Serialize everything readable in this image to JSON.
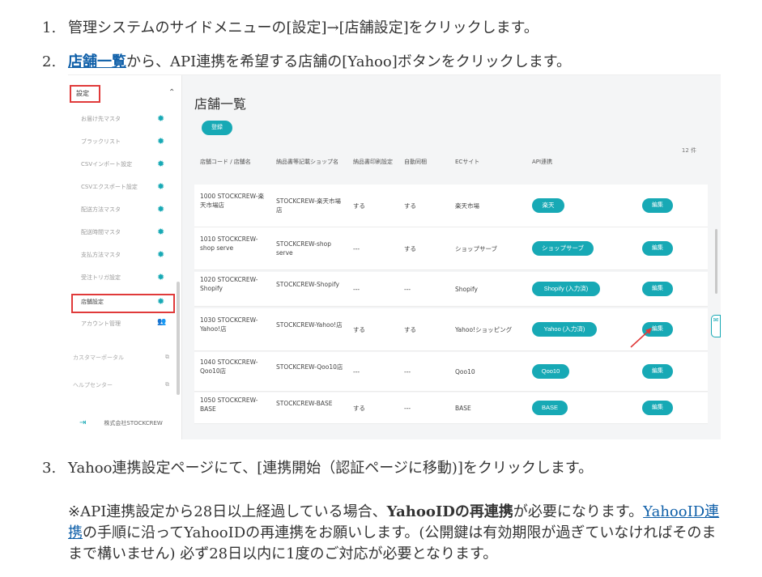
{
  "steps": [
    {
      "num": "1.",
      "text": "管理システムのサイドメニューの[設定]→[店舗設定]をクリックします。"
    },
    {
      "num": "2.",
      "link": "店舗一覧",
      "text": "から、API連携を希望する店舗の[Yahoo]ボタンをクリックします。"
    },
    {
      "num": "3.",
      "text": "Yahoo連携設定ページにて、[連携開始（認証ページに移動)]をクリックします。"
    }
  ],
  "note": {
    "prefix": "※API連携設定から28日以上経過している場合、",
    "bold": "YahooIDの再連携",
    "mid": "が必要になります。",
    "link": "YahooID連携",
    "suffix": "の手順に沿ってYahooIDの再連携をお願いします。(公開鍵は有効期限が過ぎていなければそのままで構いません) 必ず28日以内に1度のご対応が必要となります。"
  },
  "sidebar": {
    "header": "設定",
    "items": [
      "お届け先マスタ",
      "ブラックリスト",
      "CSVインポート設定",
      "CSVエクスポート設定",
      "配送方法マスタ",
      "配送時間マスタ",
      "支払方法マスタ",
      "受注トリガ設定",
      "店舗設定",
      "アカウント管理"
    ],
    "sections": [
      "カスタマーポータル",
      "ヘルプセンター"
    ],
    "footer": "株式会社STOCKCREW"
  },
  "main": {
    "title": "店舗一覧",
    "register": "登録",
    "count": "12 件",
    "headers": [
      "店舗コード / 店舗名",
      "納品書等記載ショップ名",
      "納品書印刷設定",
      "自動同梱",
      "ECサイト",
      "API連携"
    ],
    "edit_label": "編集",
    "rows": [
      {
        "code": "1000 STOCKCREW-楽天市場店",
        "shop": "STOCKCREW-楽天市場店",
        "print": "する",
        "bundle": "する",
        "ec": "楽天市場",
        "api": "楽天"
      },
      {
        "code": "1010 STOCKCREW-shop serve",
        "shop": "STOCKCREW-shop serve",
        "print": "---",
        "bundle": "する",
        "ec": "ショップサーブ",
        "api": "ショップサーブ"
      },
      {
        "code": "1020 STOCKCREW-Shopify",
        "shop": "STOCKCREW-Shopify",
        "print": "---",
        "bundle": "---",
        "ec": "Shopify",
        "api": "Shopify (入力済)"
      },
      {
        "code": "1030 STOCKCREW-Yahoo!店",
        "shop": "STOCKCREW-Yahoo!店",
        "print": "する",
        "bundle": "する",
        "ec": "Yahoo!ショッピング",
        "api": "Yahoo (入力済)"
      },
      {
        "code": "1040 STOCKCREW-Qoo10店",
        "shop": "STOCKCREW-Qoo10店",
        "print": "---",
        "bundle": "---",
        "ec": "Qoo10",
        "api": "Qoo10"
      },
      {
        "code": "1050 STOCKCREW-BASE",
        "shop": "STOCKCREW-BASE",
        "print": "する",
        "bundle": "---",
        "ec": "BASE",
        "api": "BASE"
      }
    ]
  },
  "colors": {
    "accent": "#17a9b5",
    "highlight": "#e03a3a",
    "link": "#0d5ea8"
  }
}
